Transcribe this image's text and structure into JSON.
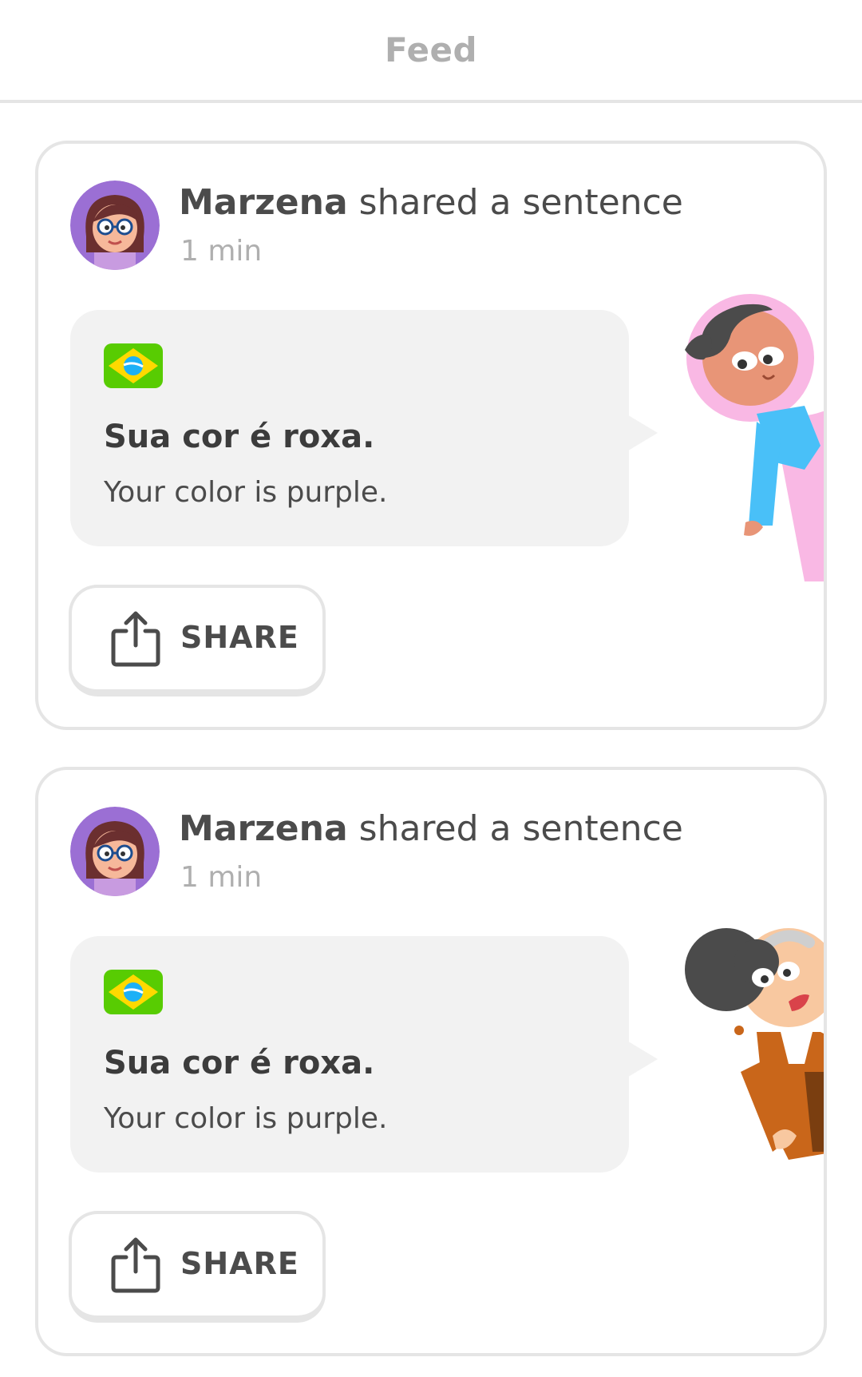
{
  "header": {
    "title": "Feed"
  },
  "posts": [
    {
      "name": "Marzena",
      "action": " shared a sentence",
      "time": "1 min",
      "sentence": "Sua cor é roxa.",
      "translation": "Your color is purple.",
      "share_label": "SHARE",
      "flag": "brazil-flag",
      "character": "girl-in-pink-hijab"
    },
    {
      "name": "Marzena",
      "action": " shared a sentence",
      "time": "1 min",
      "sentence": "Sua cor é roxa.",
      "translation": "Your color is purple.",
      "share_label": "SHARE",
      "flag": "brazil-flag",
      "character": "grandma-with-brown-jacket"
    }
  ],
  "colors": {
    "border": "#e5e5e5",
    "bubble": "#f2f2f2",
    "muted_text": "#afafaf",
    "text": "#4b4b4b",
    "avatar_bg": "#9b6fd4",
    "flag_green": "#58cc02",
    "flag_yellow": "#ffd900",
    "flag_blue": "#1cb0f6"
  }
}
